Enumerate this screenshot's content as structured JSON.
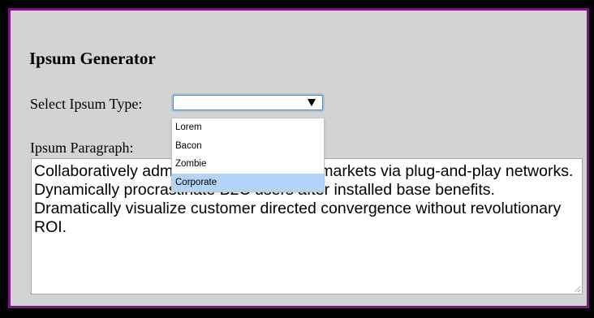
{
  "title": "Ipsum Generator",
  "select": {
    "label": "Select Ipsum Type:",
    "value": "",
    "options": [
      "Lorem",
      "Bacon",
      "Zombie",
      "Corporate"
    ],
    "highlighted": "Corporate"
  },
  "paragraph": {
    "label": "Ipsum Paragraph:",
    "text": "Collaboratively administrate empowered markets via plug-and-play networks. Dynamically procrastinate B2C users after installed base benefits. Dramatically visualize customer directed convergence without revolutionary ROI."
  },
  "colors": {
    "page_background": "#d3d3d3",
    "frame_border": "#7a1680",
    "selected_option": "#b4d4f7",
    "focus_ring": "#3b8fd8"
  }
}
